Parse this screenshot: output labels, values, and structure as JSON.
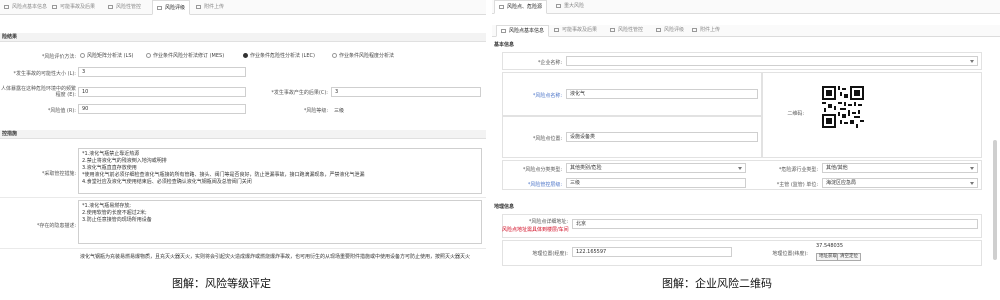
{
  "left": {
    "tabs": [
      "风险点基本信息",
      "可能事故及后果",
      "风险性管控",
      "风险评级",
      "附件上传"
    ],
    "sec_evaluation": "险结果",
    "method": {
      "label": "*风险评价方法:",
      "options": [
        "风险矩阵分析法 (LS)",
        "作业条件风险分析法修订 (MES)",
        "作业条件危险性分析法 (LEC)",
        "作业条件风险程度分析法"
      ],
      "selected_index": 2
    },
    "likelihood": {
      "label": "*发生事故的可能性大小 (L):",
      "value": "3"
    },
    "exposure": {
      "label": "人体暴露在这种危险环境中的频繁程度 (E):",
      "value": "10"
    },
    "consequence": {
      "label": "*发生事故产生的后果(C):",
      "value": "3"
    },
    "risk_value": {
      "label": "*风险值 (R):",
      "value": "90"
    },
    "risk_level": {
      "label": "*风险等级:",
      "value": "三级"
    },
    "sec_control": "控措施",
    "measures": {
      "label": "*采取管控措施:",
      "lines": [
        "*1.液化气瓶禁止靠近热源",
        "2.禁止将液化气的残液倒入地沟或明排",
        "3.液化气瓶直直存放使用",
        "*使用液化气前必须仔细检查液化气瓶接的所有管路、接头、阀门等是否良好，防止泄漏事故，接口跑滴漏现象，严禁液化气泄漏",
        "4.食堂社应及液化气使用结束后、必须检查确认液化气钢瓶阀及总管阀门关闭"
      ]
    },
    "existing": {
      "label": "*存在的隐患描述:",
      "lines": [
        "*1.液化气瓶易燃存放;",
        "2.使用软管的长度不超过2米;",
        "3.防止任意接管向现场所用设备"
      ]
    },
    "bottom_text": "液化气钢瓶为充装易燃易爆物质，且充灭火器灭火，实则将会引起灾火造成爆炸或燃烧爆炸事故，也可用衍生的从现场重要附件措施或中使用设备方可防止使用，按照灭火器灭火"
  },
  "right": {
    "tabs": [
      "风险点、危险源",
      "重大风险"
    ],
    "subtabs": [
      "风险点基本信息",
      "可能事故及后果",
      "风险性管控",
      "风险评级",
      "附件上传"
    ],
    "sec_basic": "基本信息",
    "enterprise": {
      "label": "*企业名称:",
      "value": ""
    },
    "risk_name": {
      "label": "*风险点名称:",
      "value": "液化气"
    },
    "qr_label": "二维码:",
    "risk_location": {
      "label": "*风险点位置:",
      "value": "设施设备类"
    },
    "risk_type": {
      "label": "*风险点分类类型:",
      "value": "其他类别/危险"
    },
    "major_sub": {
      "label": "*危险源行业类型:",
      "value": "其他/其他"
    },
    "control_level": {
      "label": "*风险管控层级:",
      "value": "三级"
    },
    "owner": {
      "label": "*主管 (监管) 单位:",
      "value": "海淀区应急局"
    },
    "sec_geo": "地理信息",
    "address": {
      "label": "*风险点详细地址:",
      "value": "北京",
      "note": "风险点地址需具体到楼层/车间"
    },
    "lng": {
      "label": "地理位置(经度):",
      "value": "122.165597"
    },
    "lat": {
      "label": "地理位置(纬度):",
      "value": "37.548035"
    },
    "btn_pick": "地址获取",
    "btn_clear": "清空定位"
  },
  "captions": {
    "left": "图解：风险等级评定",
    "right": "图解：企业风险二维码"
  }
}
